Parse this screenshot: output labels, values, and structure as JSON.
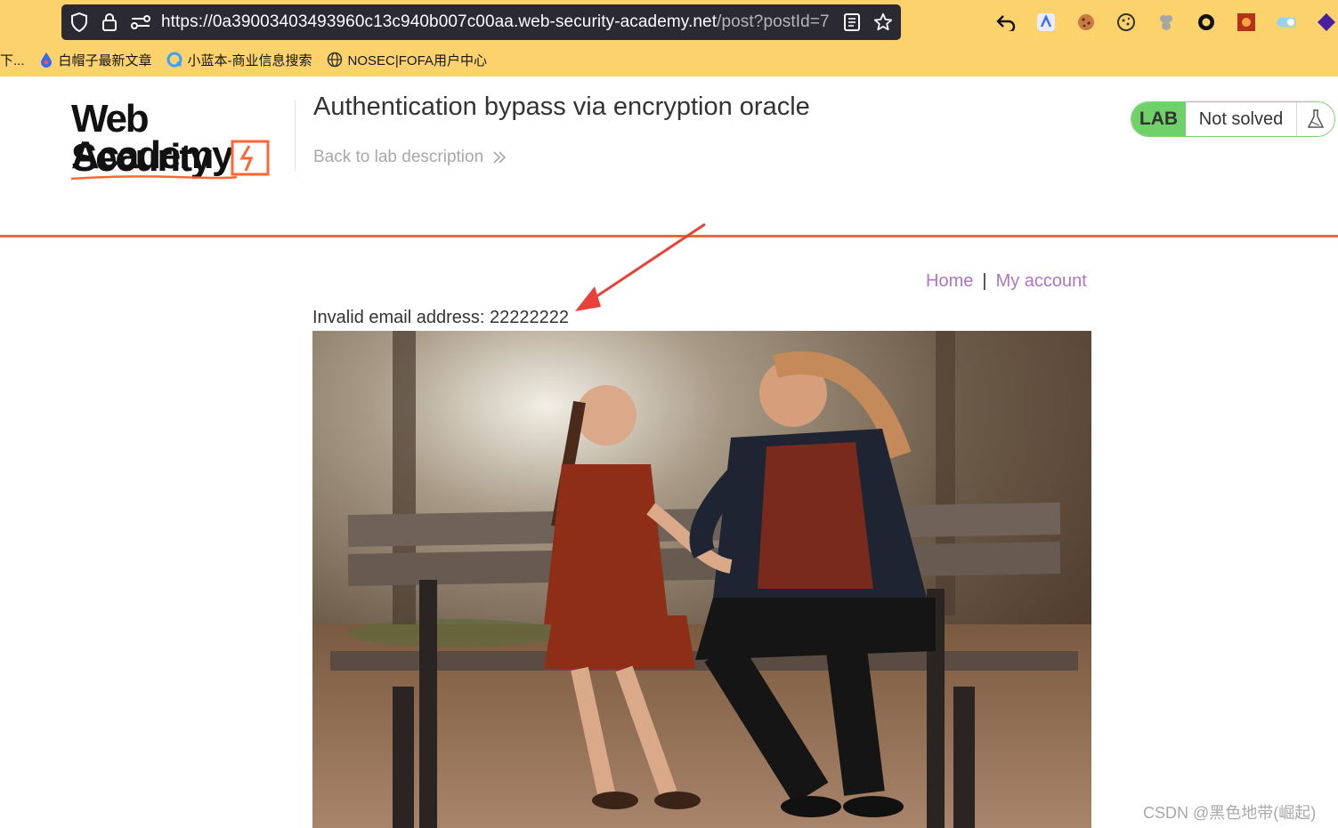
{
  "browser": {
    "url_host": "https://0a39003403493960c13c940b007c00aa.web-security-academy.net",
    "url_path": "/post?postId=7",
    "extensions": [
      "back-arrow-icon",
      "kimi-icon",
      "cookie-icon",
      "cookie-editor-icon",
      "puzzle-icon",
      "circle-icon",
      "sun-icon",
      "toggle-icon",
      "diamond-icon"
    ],
    "bookmarks": [
      {
        "label": "下...",
        "icon": "none"
      },
      {
        "label": "白帽子最新文章",
        "icon": "drop-icon",
        "color": "#2f6bff"
      },
      {
        "label": "小蓝本-商业信息搜索",
        "icon": "q-icon",
        "color": "#3aa0ff"
      },
      {
        "label": "NOSEC|FOFA用户中心",
        "icon": "globe-icon",
        "color": "#333333"
      }
    ]
  },
  "header": {
    "logo_line1": "Web Security",
    "logo_line2": "Academy",
    "lab_title": "Authentication bypass via encryption oracle",
    "back_link": "Back to lab description",
    "lab_badge": "LAB",
    "lab_status": "Not solved"
  },
  "nav": {
    "home": "Home",
    "separator": "|",
    "my_account": "My account"
  },
  "main": {
    "error_message": "Invalid email address: 22222222"
  },
  "watermark": "CSDN @黑色地带(崛起)",
  "colors": {
    "browser_bar": "#fcd26c",
    "accent_orange": "#ff6633",
    "lab_green": "#70d16b",
    "link_purple": "#ae75c5",
    "annotation_red": "#e8413a"
  }
}
